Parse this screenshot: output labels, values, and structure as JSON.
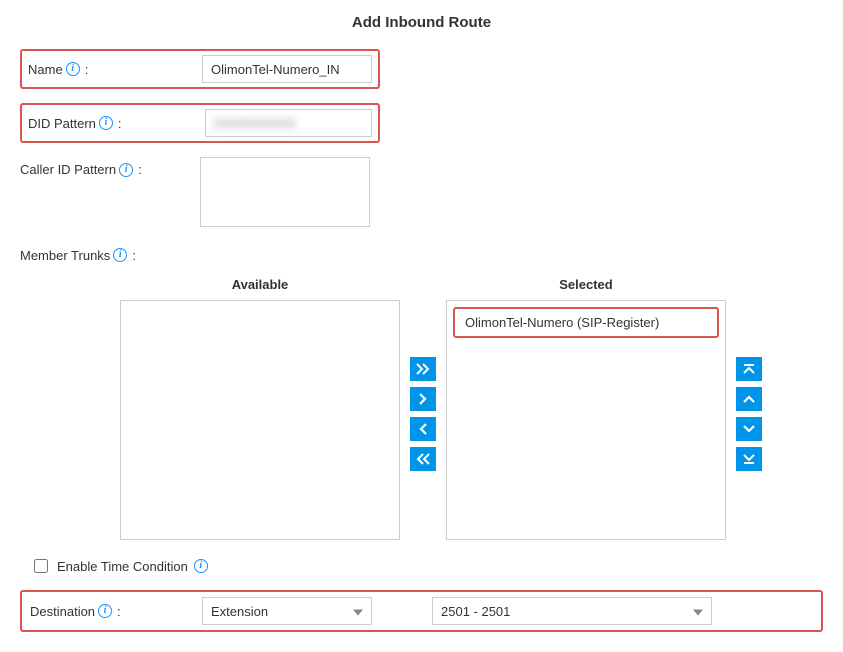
{
  "title": "Add Inbound Route",
  "fields": {
    "name": {
      "label": "Name",
      "value": "OlimonTel-Numero_IN"
    },
    "did": {
      "label": "DID Pattern",
      "value": "0000000000"
    },
    "cid": {
      "label": "Caller ID Pattern",
      "value": ""
    },
    "trunks": {
      "label": "Member Trunks"
    },
    "etc": {
      "label": "Enable Time Condition"
    },
    "dest": {
      "label": "Destination"
    }
  },
  "trunks": {
    "available_header": "Available",
    "selected_header": "Selected",
    "available_items": [],
    "selected_items": [
      "OlimonTel-Numero (SIP-Register)"
    ]
  },
  "destination": {
    "type": "Extension",
    "value": "2501 - 2501"
  }
}
